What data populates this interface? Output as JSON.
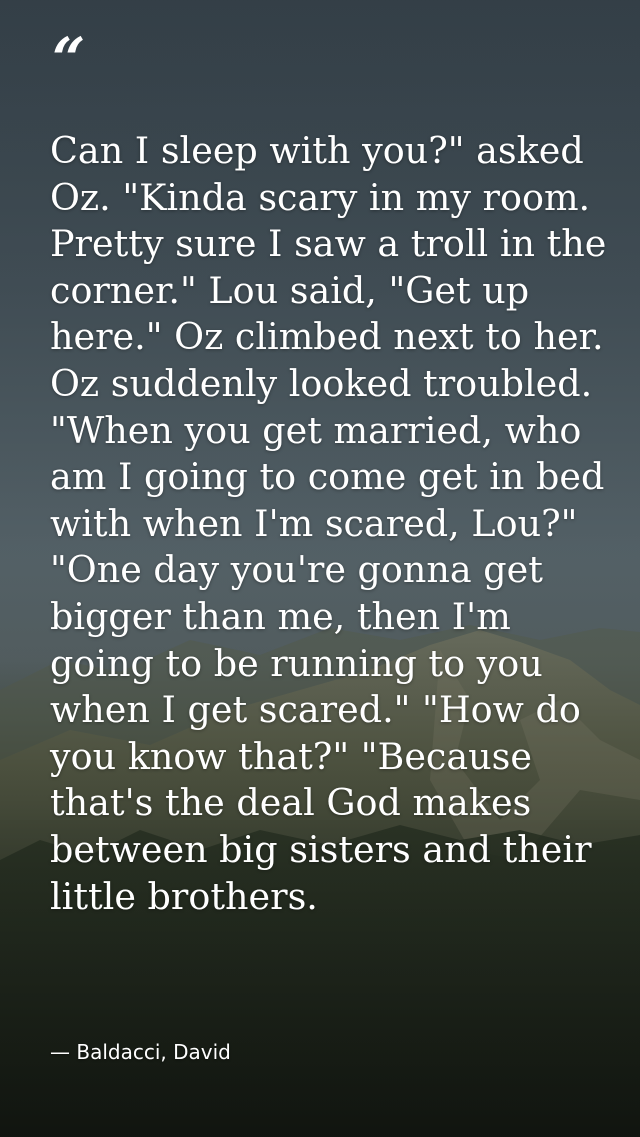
{
  "quote": {
    "open_mark": "“",
    "text": "Can I sleep with you?\" asked Oz. \"Kinda scary in my room. Pretty sure I saw a troll in the corner.\" Lou said, \"Get up here.\" Oz climbed next to her. Oz suddenly looked troubled. \"When you get married, who am I going to come get in bed with when I'm scared, Lou?\" \"One day you're gonna get bigger than me, then I'm going to be running to you when I get scared.\" \"How do you know that?\" \"Because that's the deal God makes between big sisters and their little brothers.",
    "attribution": "— Baldacci, David"
  },
  "background": {
    "subject": "mountain landscape under overcast sky",
    "colors": {
      "sky_top": "#3f4c55",
      "sky_mid": "#5c6a70",
      "mountain": "#6b6f5a",
      "forest": "#1c2318"
    }
  }
}
